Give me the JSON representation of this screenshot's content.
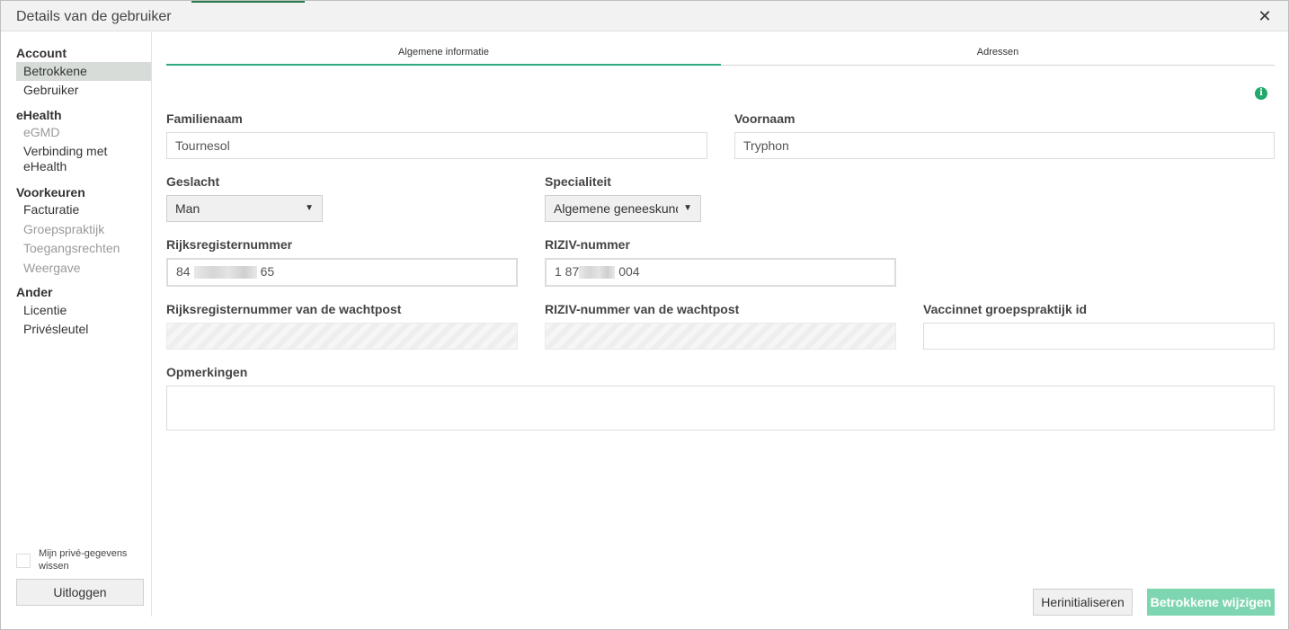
{
  "dialog": {
    "title": "Details van de gebruiker"
  },
  "sidebar": {
    "account_header": "Account",
    "betrokkene": "Betrokkene",
    "gebruiker": "Gebruiker",
    "ehealth_header": "eHealth",
    "egmd": "eGMD",
    "verbinding": "Verbinding met eHealth",
    "voorkeuren_header": "Voorkeuren",
    "facturatie": "Facturatie",
    "groepspraktijk": "Groepspraktijk",
    "toegangsrechten": "Toegangsrechten",
    "weergave": "Weergave",
    "ander_header": "Ander",
    "licentie": "Licentie",
    "privesleutel": "Privésleutel",
    "wipe_label": "Mijn privé-gegevens wissen",
    "logout": "Uitloggen"
  },
  "tabs": {
    "algemeen": "Algemene informatie",
    "adressen": "Adressen"
  },
  "form": {
    "familienaam_label": "Familienaam",
    "familienaam_value": "Tournesol",
    "voornaam_label": "Voornaam",
    "voornaam_value": "Tryphon",
    "geslacht_label": "Geslacht",
    "geslacht_value": "Man",
    "specialiteit_label": "Specialiteit",
    "specialiteit_value": "Algemene geneeskunde",
    "rijksregister_label": "Rijksregisternummer",
    "rijksregister_prefix": "84",
    "rijksregister_suffix": "65",
    "riziv_label": "RIZIV-nummer",
    "riziv_prefix": "1 87",
    "riziv_suffix": "004",
    "rr_wachtpost_label": "Rijksregisternummer van de wachtpost",
    "riziv_wachtpost_label": "RIZIV-nummer van de wachtpost",
    "vaccinnet_label": "Vaccinnet groepspraktijk id",
    "opmerkingen_label": "Opmerkingen"
  },
  "buttons": {
    "reset": "Herinitialiseren",
    "save": "Betrokkene wijzigen"
  },
  "colors": {
    "accent": "#2daa7d",
    "save_button": "#7ed6b0",
    "active_sidebar": "#d7dcd9"
  }
}
